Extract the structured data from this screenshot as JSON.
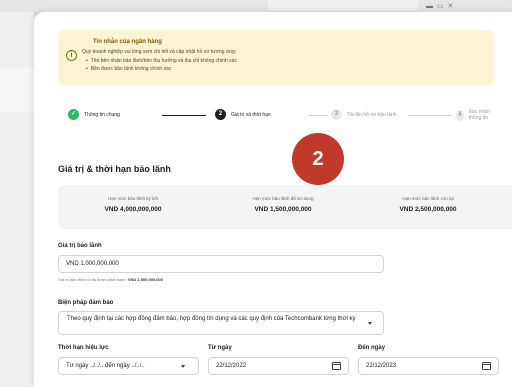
{
  "notice": {
    "title": "Tin nhắn của ngân hàng",
    "description": "Quý doanh nghiệp vui lòng xem chi tiết và cập nhật hồ sơ tương ứng:",
    "items": [
      "Tên bên nhận bảo lãnh/bên thụ hưởng và địa chỉ không chính xác",
      "Bên được bảo lãnh không chính xác"
    ]
  },
  "stepper": {
    "steps": [
      {
        "number": "✓",
        "label": "Thông tin chung",
        "state": "done"
      },
      {
        "number": "2",
        "label": "Giá trị và thời hạn",
        "state": "active"
      },
      {
        "number": "3",
        "label": "Tải lên hồ sơ bảo lãnh",
        "state": "todo"
      },
      {
        "number": "4",
        "label": "Xác nhận thông tin",
        "state": "todo"
      }
    ]
  },
  "badge": "2",
  "section_title": "Giá trị & thời hạn bảo lãnh",
  "limits": [
    {
      "label": "Hạn mức bảo lãnh ký kết",
      "value": "VND 4,000,000,000"
    },
    {
      "label": "Hạn mức bảo lãnh đã sử dụng",
      "value": "VND 1,500,000,000"
    },
    {
      "label": "Hạn mức bảo lãnh còn lại",
      "value": "VND 2,500,000,000"
    }
  ],
  "guarantee_value": {
    "label": "Giá trị bảo lãnh",
    "value": "VND 1,000,000,000",
    "hint_prefix": "Giá trị bảo lãnh tối đa được phát hành:",
    "hint_value": "VND 2,500,000,000"
  },
  "guarantee_measure": {
    "label": "Biện pháp đảm bảo",
    "value": "Theo quy định tại các hợp đồng đảm bảo, hợp đồng tín dụng và các quy định của Techcombank từng thời kỳ"
  },
  "validity": {
    "label": "Thời hạn hiệu lực",
    "value": "Từ ngày ../../.. đến ngày ../../.."
  },
  "from_date": {
    "label": "Từ ngày",
    "value": "22/12/2022"
  },
  "to_date": {
    "label": "Đến ngày",
    "value": "22/12/2023"
  },
  "colors": {
    "accent_done": "#2fb56a",
    "badge": "#c0392b",
    "notice_bg": "#fdf4d4"
  }
}
